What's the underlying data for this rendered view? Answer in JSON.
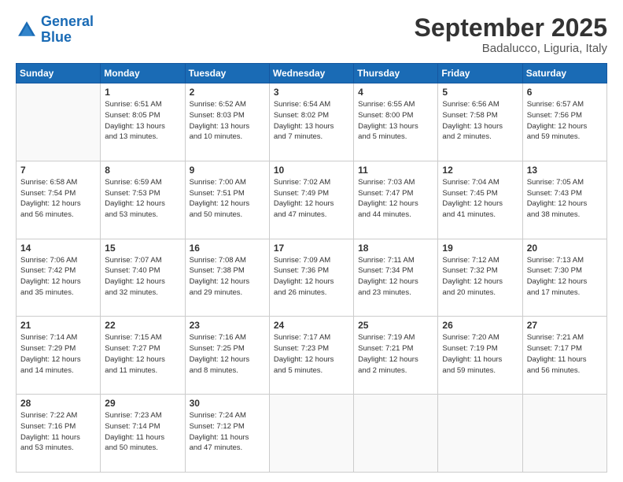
{
  "header": {
    "logo_general": "General",
    "logo_blue": "Blue",
    "month_title": "September 2025",
    "location": "Badalucco, Liguria, Italy"
  },
  "weekdays": [
    "Sunday",
    "Monday",
    "Tuesday",
    "Wednesday",
    "Thursday",
    "Friday",
    "Saturday"
  ],
  "weeks": [
    [
      {
        "day": "",
        "info": ""
      },
      {
        "day": "1",
        "info": "Sunrise: 6:51 AM\nSunset: 8:05 PM\nDaylight: 13 hours\nand 13 minutes."
      },
      {
        "day": "2",
        "info": "Sunrise: 6:52 AM\nSunset: 8:03 PM\nDaylight: 13 hours\nand 10 minutes."
      },
      {
        "day": "3",
        "info": "Sunrise: 6:54 AM\nSunset: 8:02 PM\nDaylight: 13 hours\nand 7 minutes."
      },
      {
        "day": "4",
        "info": "Sunrise: 6:55 AM\nSunset: 8:00 PM\nDaylight: 13 hours\nand 5 minutes."
      },
      {
        "day": "5",
        "info": "Sunrise: 6:56 AM\nSunset: 7:58 PM\nDaylight: 13 hours\nand 2 minutes."
      },
      {
        "day": "6",
        "info": "Sunrise: 6:57 AM\nSunset: 7:56 PM\nDaylight: 12 hours\nand 59 minutes."
      }
    ],
    [
      {
        "day": "7",
        "info": "Sunrise: 6:58 AM\nSunset: 7:54 PM\nDaylight: 12 hours\nand 56 minutes."
      },
      {
        "day": "8",
        "info": "Sunrise: 6:59 AM\nSunset: 7:53 PM\nDaylight: 12 hours\nand 53 minutes."
      },
      {
        "day": "9",
        "info": "Sunrise: 7:00 AM\nSunset: 7:51 PM\nDaylight: 12 hours\nand 50 minutes."
      },
      {
        "day": "10",
        "info": "Sunrise: 7:02 AM\nSunset: 7:49 PM\nDaylight: 12 hours\nand 47 minutes."
      },
      {
        "day": "11",
        "info": "Sunrise: 7:03 AM\nSunset: 7:47 PM\nDaylight: 12 hours\nand 44 minutes."
      },
      {
        "day": "12",
        "info": "Sunrise: 7:04 AM\nSunset: 7:45 PM\nDaylight: 12 hours\nand 41 minutes."
      },
      {
        "day": "13",
        "info": "Sunrise: 7:05 AM\nSunset: 7:43 PM\nDaylight: 12 hours\nand 38 minutes."
      }
    ],
    [
      {
        "day": "14",
        "info": "Sunrise: 7:06 AM\nSunset: 7:42 PM\nDaylight: 12 hours\nand 35 minutes."
      },
      {
        "day": "15",
        "info": "Sunrise: 7:07 AM\nSunset: 7:40 PM\nDaylight: 12 hours\nand 32 minutes."
      },
      {
        "day": "16",
        "info": "Sunrise: 7:08 AM\nSunset: 7:38 PM\nDaylight: 12 hours\nand 29 minutes."
      },
      {
        "day": "17",
        "info": "Sunrise: 7:09 AM\nSunset: 7:36 PM\nDaylight: 12 hours\nand 26 minutes."
      },
      {
        "day": "18",
        "info": "Sunrise: 7:11 AM\nSunset: 7:34 PM\nDaylight: 12 hours\nand 23 minutes."
      },
      {
        "day": "19",
        "info": "Sunrise: 7:12 AM\nSunset: 7:32 PM\nDaylight: 12 hours\nand 20 minutes."
      },
      {
        "day": "20",
        "info": "Sunrise: 7:13 AM\nSunset: 7:30 PM\nDaylight: 12 hours\nand 17 minutes."
      }
    ],
    [
      {
        "day": "21",
        "info": "Sunrise: 7:14 AM\nSunset: 7:29 PM\nDaylight: 12 hours\nand 14 minutes."
      },
      {
        "day": "22",
        "info": "Sunrise: 7:15 AM\nSunset: 7:27 PM\nDaylight: 12 hours\nand 11 minutes."
      },
      {
        "day": "23",
        "info": "Sunrise: 7:16 AM\nSunset: 7:25 PM\nDaylight: 12 hours\nand 8 minutes."
      },
      {
        "day": "24",
        "info": "Sunrise: 7:17 AM\nSunset: 7:23 PM\nDaylight: 12 hours\nand 5 minutes."
      },
      {
        "day": "25",
        "info": "Sunrise: 7:19 AM\nSunset: 7:21 PM\nDaylight: 12 hours\nand 2 minutes."
      },
      {
        "day": "26",
        "info": "Sunrise: 7:20 AM\nSunset: 7:19 PM\nDaylight: 11 hours\nand 59 minutes."
      },
      {
        "day": "27",
        "info": "Sunrise: 7:21 AM\nSunset: 7:17 PM\nDaylight: 11 hours\nand 56 minutes."
      }
    ],
    [
      {
        "day": "28",
        "info": "Sunrise: 7:22 AM\nSunset: 7:16 PM\nDaylight: 11 hours\nand 53 minutes."
      },
      {
        "day": "29",
        "info": "Sunrise: 7:23 AM\nSunset: 7:14 PM\nDaylight: 11 hours\nand 50 minutes."
      },
      {
        "day": "30",
        "info": "Sunrise: 7:24 AM\nSunset: 7:12 PM\nDaylight: 11 hours\nand 47 minutes."
      },
      {
        "day": "",
        "info": ""
      },
      {
        "day": "",
        "info": ""
      },
      {
        "day": "",
        "info": ""
      },
      {
        "day": "",
        "info": ""
      }
    ]
  ]
}
